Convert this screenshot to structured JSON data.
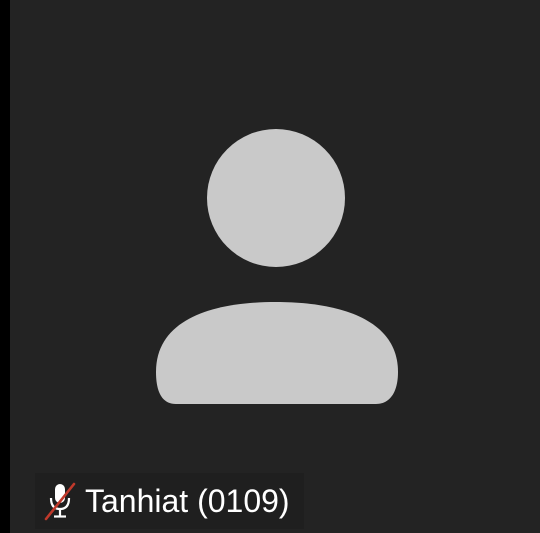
{
  "participant": {
    "name": "Tanhiat (0109)",
    "mic_state": "muted",
    "mic_icon": "microphone-muted-icon",
    "avatar_icon": "default-user-avatar-icon"
  },
  "colors": {
    "tile_background": "#232323",
    "avatar_fill": "#c9c9c9",
    "mute_slash": "#c0392b",
    "name_text": "#ffffff"
  }
}
